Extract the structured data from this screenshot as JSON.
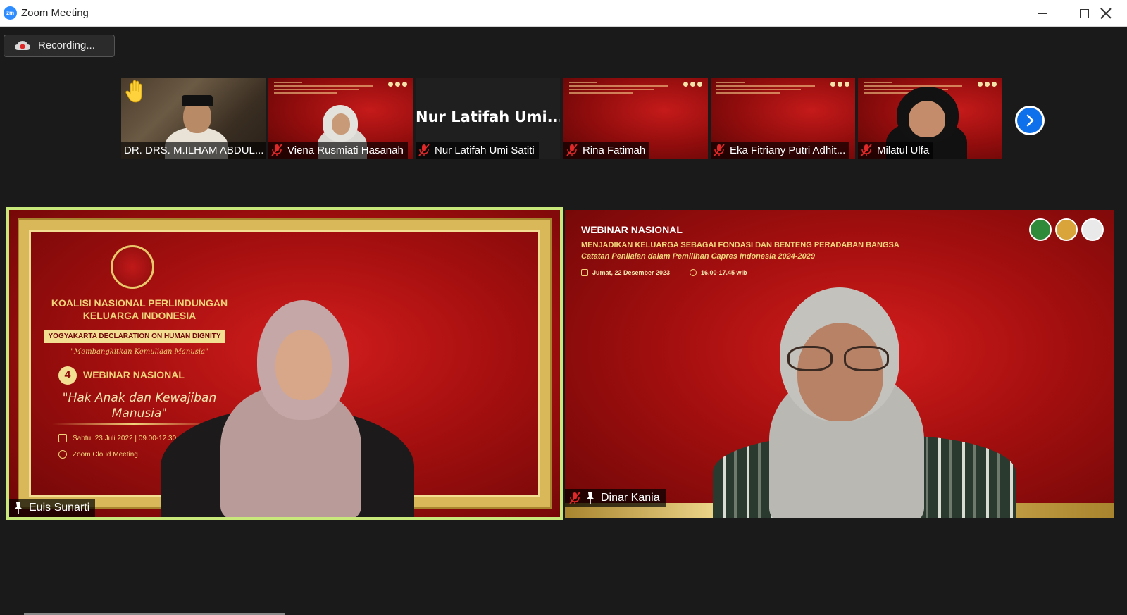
{
  "window": {
    "title": "Zoom Meeting",
    "logo_text": "zm"
  },
  "recording": {
    "label": "Recording..."
  },
  "thumbnails": [
    {
      "name": "DR. DRS. M.ILHAM ABDUL...",
      "muted": false,
      "raised_hand": true,
      "style": "room"
    },
    {
      "name": "Viena Rusmiati Hasanah",
      "muted": true,
      "style": "red"
    },
    {
      "name": "Nur Latifah Umi Satiti",
      "display_name": "Nur Latifah Umi...",
      "muted": true,
      "style": "dark"
    },
    {
      "name": "Rina Fatimah",
      "muted": true,
      "style": "red"
    },
    {
      "name": "Eka Fitriany Putri Adhit...",
      "muted": true,
      "style": "red"
    },
    {
      "name": "Milatul Ulfa",
      "muted": true,
      "style": "red"
    }
  ],
  "speakers": {
    "left": {
      "name": "Euis Sunarti",
      "org_line1": "KOALISI NASIONAL PERLINDUNGAN",
      "org_line2": "KELUARGA INDONESIA",
      "badge": "YOGYAKARTA DECLARATION ON HUMAN DIGNITY",
      "motto": "\"Membangkitkan Kemuliaan Manusia\"",
      "number": "4",
      "webinar": "WEBINAR NASIONAL",
      "talk_line1": "\"Hak Anak dan Kewajiban",
      "talk_line2": "Manusia\"",
      "date": "Sabtu, 23 Juli 2022 | 09.00-12.30 wib",
      "platform": "Zoom Cloud Meeting"
    },
    "right": {
      "name": "Dinar Kania",
      "webinar": "WEBINAR NASIONAL",
      "theme": "MENJADIKAN KELUARGA SEBAGAI FONDASI DAN BENTENG PERADABAN BANGSA",
      "subtitle": "Catatan Penilaian dalam Pemilihan Capres Indonesia 2024-2029",
      "date": "Jumat, 22 Desember 2023",
      "time": "16.00-17.45 wib"
    }
  },
  "colors": {
    "accent": "#0e71eb",
    "active_speaker_border": "#c9e87b",
    "banner_red": "#b31414",
    "gold": "#f2d37a"
  }
}
